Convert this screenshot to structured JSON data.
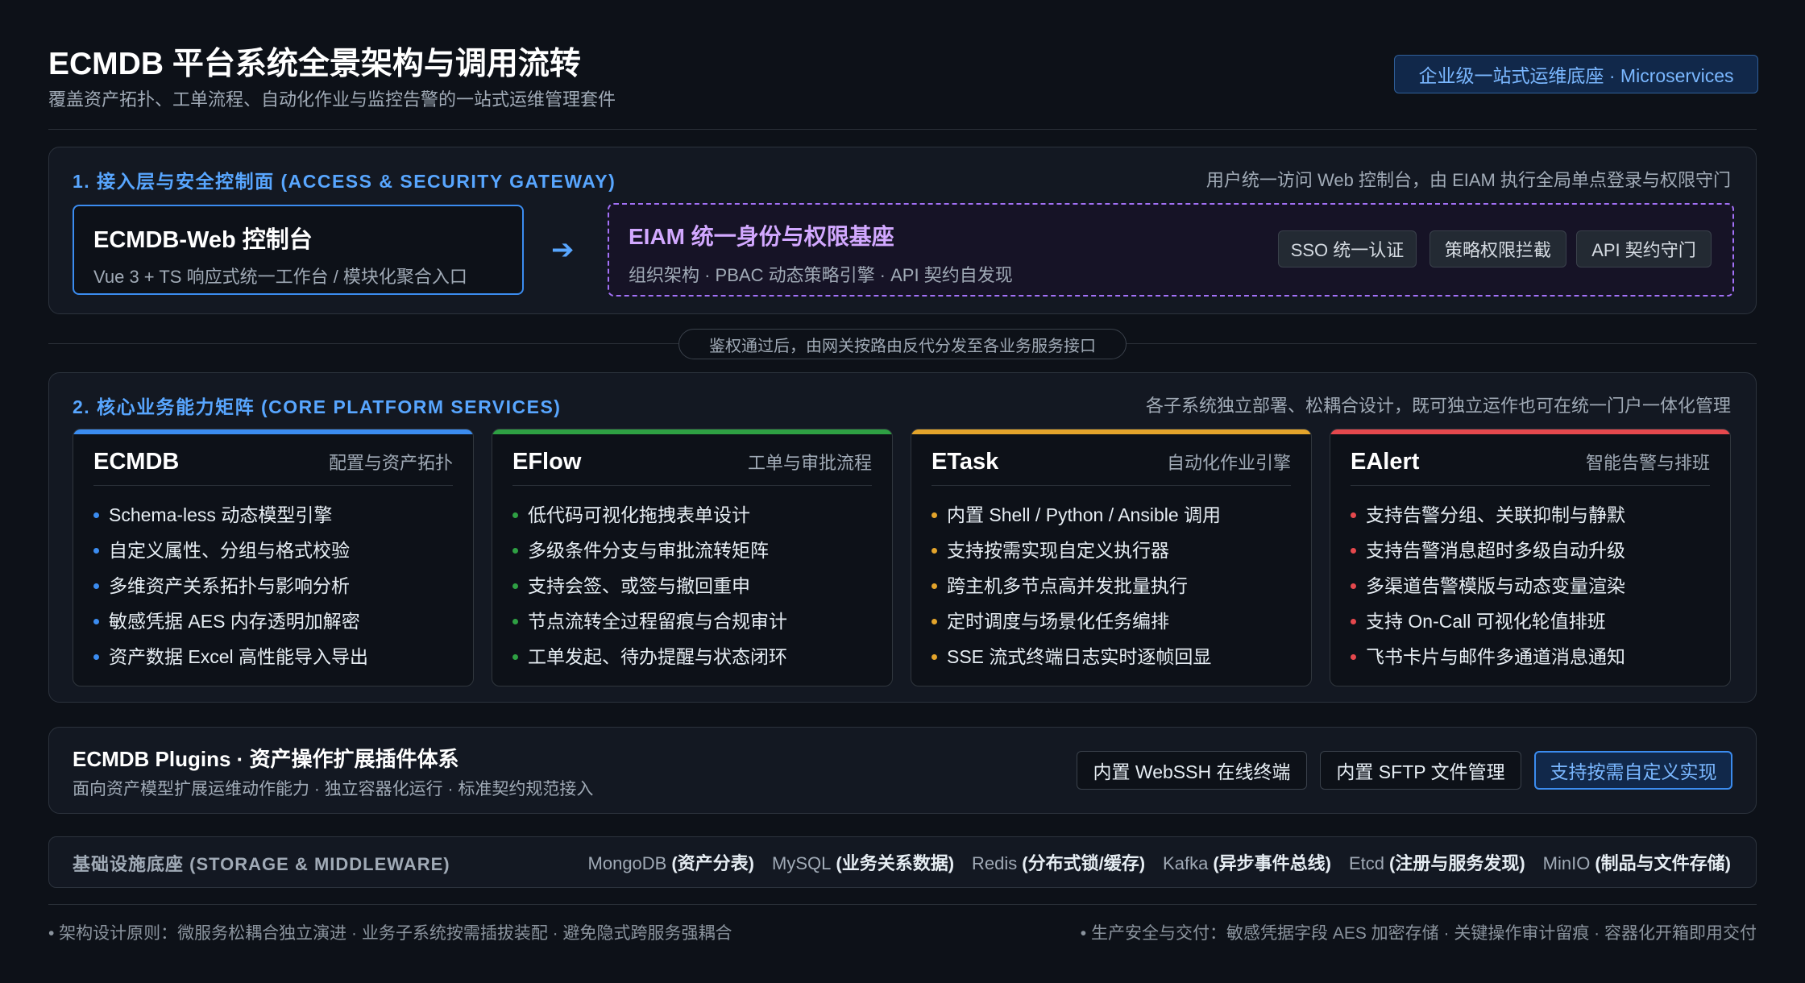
{
  "header": {
    "title": "ECMDB 平台系统全景架构与调用流转",
    "subtitle": "覆盖资产拓扑、工单流程、自动化作业与监控告警的一站式运维管理套件",
    "badge": "企业级一站式运维底座 · Microservices"
  },
  "gateway": {
    "section_title": "1. 接入层与安全控制面 (ACCESS & SECURITY GATEWAY)",
    "note": "用户统一访问 Web 控制台，由 EIAM 执行全局单点登录与权限守门",
    "web": {
      "title": "ECMDB-Web 控制台",
      "subtitle": "Vue 3 + TS 响应式统一工作台 / 模块化聚合入口"
    },
    "arrow": "➔",
    "eiam": {
      "title": "EIAM 统一身份与权限基座",
      "subtitle": "组织架构 · PBAC 动态策略引擎 · API 契约自发现",
      "tags": [
        "SSO 统一认证",
        "策略权限拦截",
        "API 契约守门"
      ]
    }
  },
  "routing_note": "鉴权通过后，由网关按路由反代分发至各业务服务接口",
  "core": {
    "section_title": "2. 核心业务能力矩阵 (CORE PLATFORM SERVICES)",
    "note": "各子系统独立部署、松耦合设计，既可独立运作也可在统一门户一体化管理",
    "cards": [
      {
        "name": "ECMDB",
        "tag": "配置与资产拓扑",
        "color": "#3b8cf0",
        "items": [
          "Schema-less 动态模型引擎",
          "自定义属性、分组与格式校验",
          "多维资产关系拓扑与影响分析",
          "敏感凭据 AES 内存透明加解密",
          "资产数据 Excel 高性能导入导出"
        ]
      },
      {
        "name": "EFlow",
        "tag": "工单与审批流程",
        "color": "#2ea043",
        "items": [
          "低代码可视化拖拽表单设计",
          "多级条件分支与审批流转矩阵",
          "支持会签、或签与撤回重申",
          "节点流转全过程留痕与合规审计",
          "工单发起、待办提醒与状态闭环"
        ]
      },
      {
        "name": "ETask",
        "tag": "自动化作业引擎",
        "color": "#e3a42b",
        "items": [
          "内置 Shell / Python / Ansible 调用",
          "支持按需实现自定义执行器",
          "跨主机多节点高并发批量执行",
          "定时调度与场景化任务编排",
          "SSE 流式终端日志实时逐帧回显"
        ]
      },
      {
        "name": "EAlert",
        "tag": "智能告警与排班",
        "color": "#e5484d",
        "items": [
          "支持告警分组、关联抑制与静默",
          "支持告警消息超时多级自动升级",
          "多渠道告警模版与动态变量渲染",
          "支持 On-Call 可视化轮值排班",
          "飞书卡片与邮件多通道消息通知"
        ]
      }
    ]
  },
  "plugins": {
    "title": "ECMDB Plugins · 资产操作扩展插件体系",
    "subtitle": "面向资产模型扩展运维动作能力 · 独立容器化运行 · 标准契约规范接入",
    "buttons": [
      "内置 WebSSH 在线终端",
      "内置 SFTP 文件管理",
      "支持按需自定义实现"
    ]
  },
  "infra": {
    "label": "基础设施底座 (STORAGE & MIDDLEWARE)",
    "items": [
      {
        "name": "MongoDB",
        "desc": "(资产分表)"
      },
      {
        "name": "MySQL",
        "desc": "(业务关系数据)"
      },
      {
        "name": "Redis",
        "desc": "(分布式锁/缓存)"
      },
      {
        "name": "Kafka",
        "desc": "(异步事件总线)"
      },
      {
        "name": "Etcd",
        "desc": "(注册与服务发现)"
      },
      {
        "name": "MinIO",
        "desc": "(制品与文件存储)"
      }
    ]
  },
  "footer": {
    "left": "• 架构设计原则：微服务松耦合独立演进 · 业务子系统按需插拔装配 · 避免隐式跨服务强耦合",
    "right": "• 生产安全与交付：敏感凭据字段 AES 加密存储 · 关键操作审计留痕 · 容器化开箱即用交付"
  }
}
